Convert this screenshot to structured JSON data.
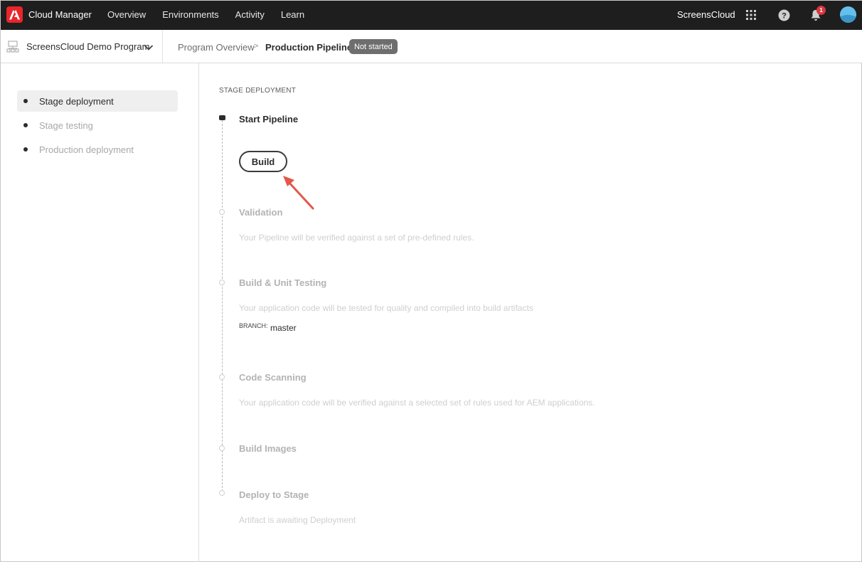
{
  "topbar": {
    "app_title": "Cloud Manager",
    "nav": [
      "Overview",
      "Environments",
      "Activity",
      "Learn"
    ],
    "org_name": "ScreensCloud",
    "notification_count": "1"
  },
  "subbar": {
    "program_name": "ScreensCloud Demo Program",
    "breadcrumb_parent": "Program Overview",
    "breadcrumb_separator": ">",
    "breadcrumb_current": "Production Pipeline",
    "status": "Not started"
  },
  "sidebar": {
    "items": [
      {
        "label": "Stage deployment",
        "active": true
      },
      {
        "label": "Stage testing",
        "active": false
      },
      {
        "label": "Production deployment",
        "active": false
      }
    ]
  },
  "main": {
    "section_label": "STAGE DEPLOYMENT",
    "start_title": "Start Pipeline",
    "build_label": "Build",
    "steps": [
      {
        "title": "Validation",
        "desc": "Your Pipeline will be verified against a set of pre-defined rules."
      },
      {
        "title": "Build & Unit Testing",
        "desc": "Your application code will be tested for quality and compiled into build artifacts"
      },
      {
        "title": "Code Scanning",
        "desc": "Your application code will be verified against a selected set of rules used for AEM applications."
      },
      {
        "title": "Build Images",
        "desc": ""
      },
      {
        "title": "Deploy to Stage",
        "desc": "Artifact is awaiting Deployment"
      }
    ],
    "branch_label": "BRANCH:",
    "branch_value": "master"
  },
  "colors": {
    "topbar_bg": "#1e1e1e",
    "adobe_red": "#e8262b",
    "annotation_arrow": "#e2584a",
    "status_pill": "#6e6e6e"
  },
  "icons": [
    "adobe-logo-icon",
    "apps-grid-icon",
    "help-icon",
    "bell-icon",
    "avatar",
    "program-icon",
    "chevron-down-icon",
    "annotation-arrow"
  ]
}
